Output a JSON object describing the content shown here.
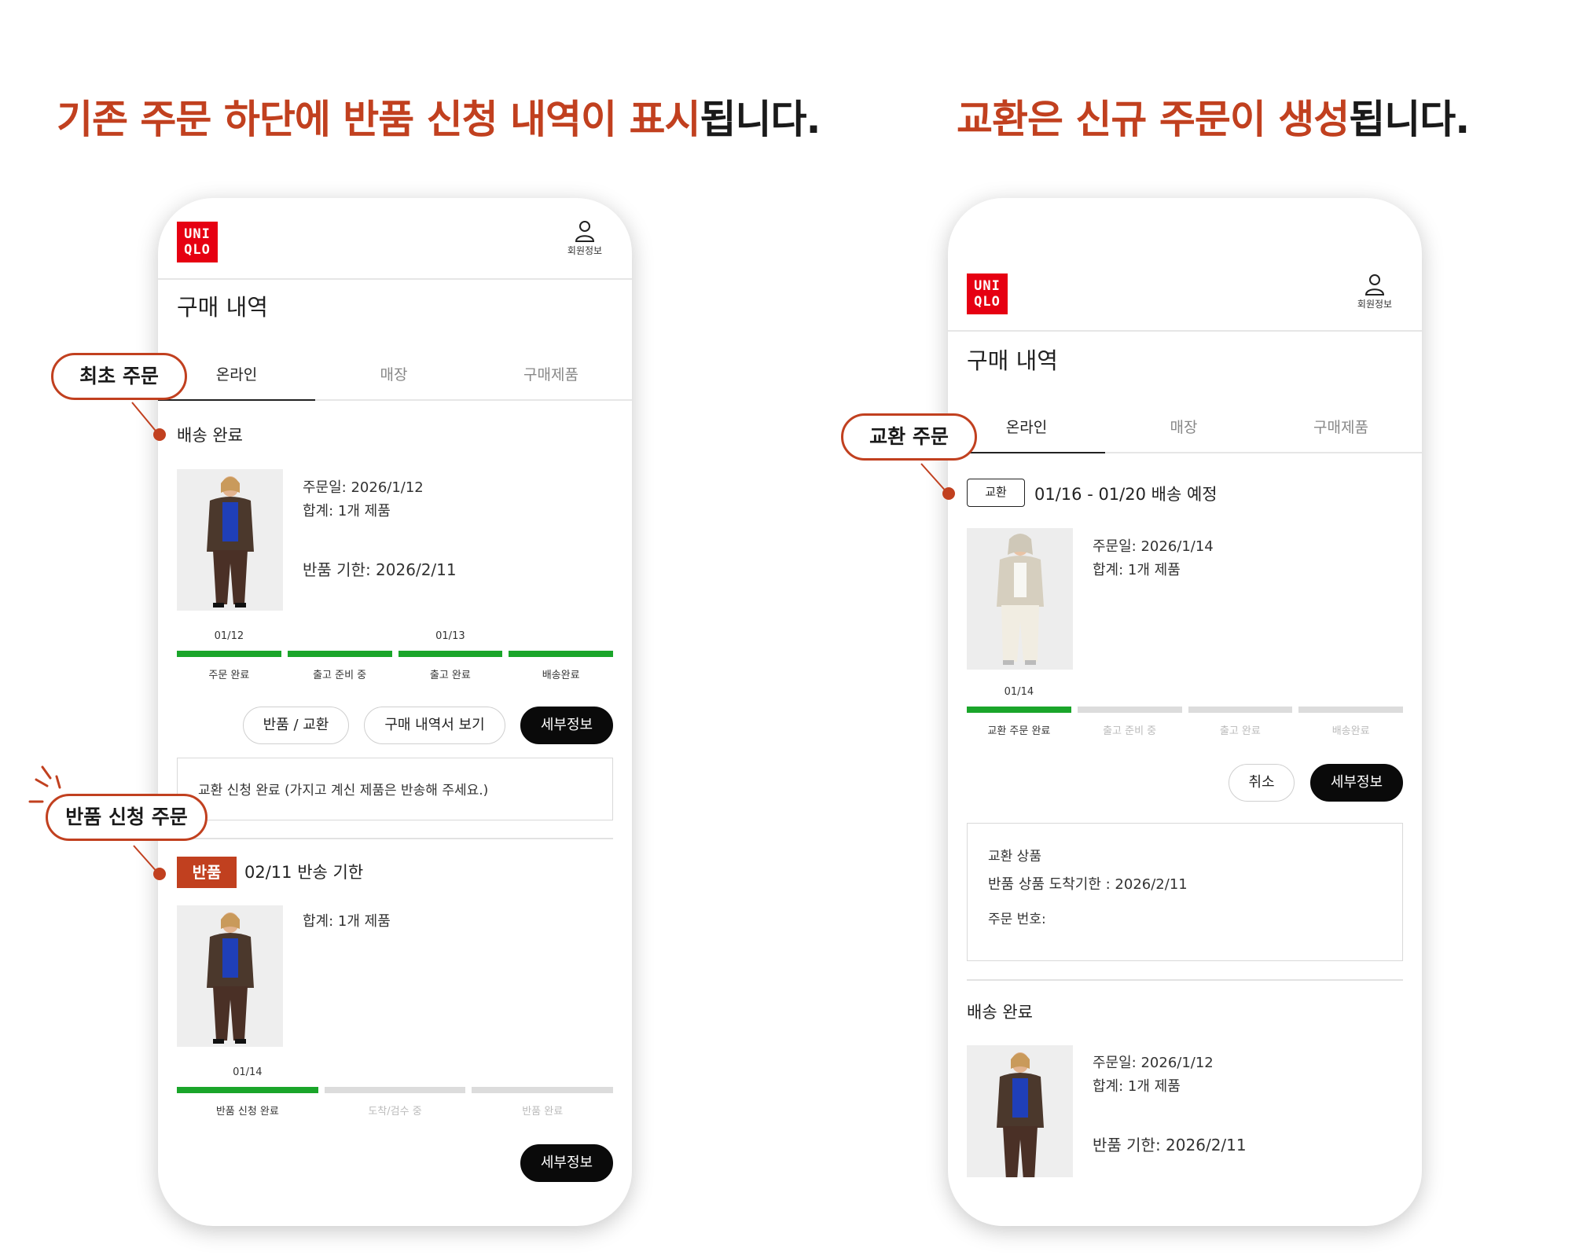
{
  "left_headline": {
    "highlight": "기존 주문 하단에 반품 신청 내역이 표시",
    "rest": "됩니다."
  },
  "right_headline": {
    "highlight": "교환은 신규 주문이 생성",
    "rest": "됩니다."
  },
  "colors": {
    "accent": "#c1401f",
    "brand_red": "#e60012",
    "progress_done": "#1aa52a",
    "progress_pending": "#dcdcdc"
  },
  "app": {
    "logo_line1": "UNI",
    "logo_line2": "QLO",
    "member_label": "회원정보",
    "member_icon": "person-icon",
    "page_title": "구매 내역",
    "tabs": [
      "온라인",
      "매장",
      "구매제품"
    ]
  },
  "callouts": {
    "original_order": "최초 주문",
    "return_order": "반품 신청 주문",
    "exchange_order": "교환 주문"
  },
  "left_phone": {
    "original": {
      "status": "배송 완료",
      "order_date": "주문일: 2026/1/12",
      "total": "합계: 1개 제품",
      "return_deadline": "반품 기한: 2026/2/11",
      "steps": [
        {
          "date": "01/12",
          "label": "주문 완료",
          "done": true
        },
        {
          "date": "",
          "label": "출고 준비 중",
          "done": true
        },
        {
          "date": "01/13",
          "label": "출고 완료",
          "done": true
        },
        {
          "date": "",
          "label": "배송완료",
          "done": true
        }
      ],
      "buttons": {
        "return_exchange": "반품 / 교환",
        "receipt": "구매 내역서 보기",
        "details": "세부정보"
      },
      "notice": "교환 신청 완료 (가지고 계신 제품은 반송해 주세요.)"
    },
    "return": {
      "badge": "반품",
      "status": "02/11 반송 기한",
      "total": "합계: 1개 제품",
      "steps": [
        {
          "date": "01/14",
          "label": "반품 신청 완료",
          "done": true
        },
        {
          "date": "",
          "label": "도착/검수 중",
          "done": false
        },
        {
          "date": "",
          "label": "반품 완료",
          "done": false
        }
      ],
      "details": "세부정보"
    }
  },
  "right_phone": {
    "exchange": {
      "badge": "교환",
      "status": "01/16 - 01/20 배송 예정",
      "order_date": "주문일: 2026/1/14",
      "total": "합계: 1개 제품",
      "steps": [
        {
          "date": "01/14",
          "label": "교환 주문 완료",
          "done": true
        },
        {
          "date": "",
          "label": "출고 준비 중",
          "done": false
        },
        {
          "date": "",
          "label": "출고 완료",
          "done": false
        },
        {
          "date": "",
          "label": "배송완료",
          "done": false
        }
      ],
      "buttons": {
        "cancel": "취소",
        "details": "세부정보"
      },
      "box": {
        "title": "교환 상품",
        "deadline": "반품 상품 도착기한 : 2026/2/11",
        "order_no": "주문 번호:"
      }
    },
    "original": {
      "status": "배송 완료",
      "order_date": "주문일: 2026/1/12",
      "total": "합계: 1개 제품",
      "return_deadline": "반품 기한: 2026/2/11"
    }
  }
}
